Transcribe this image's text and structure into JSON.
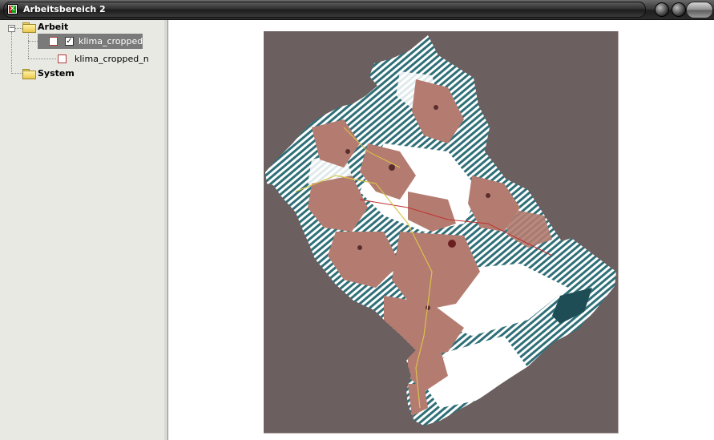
{
  "window": {
    "title": "Arbeitsbereich 2",
    "app_icon": "app-logo-icon"
  },
  "tree": {
    "root": {
      "label": "Arbeit",
      "icon": "folder-icon",
      "expanded": true,
      "children": [
        {
          "label": "klima_cropped_n",
          "checked": true,
          "selected": true
        },
        {
          "label": "klima_cropped_n",
          "checked": false,
          "selected": false
        }
      ]
    },
    "system": {
      "label": "System",
      "icon": "folder-icon"
    }
  },
  "map": {
    "background_color": "#6b5f5f",
    "hatch_color": "#2f6f78",
    "terrain_color": "#b47c70",
    "boundary_color": "#c03030",
    "road_color": "#d9c24a"
  }
}
